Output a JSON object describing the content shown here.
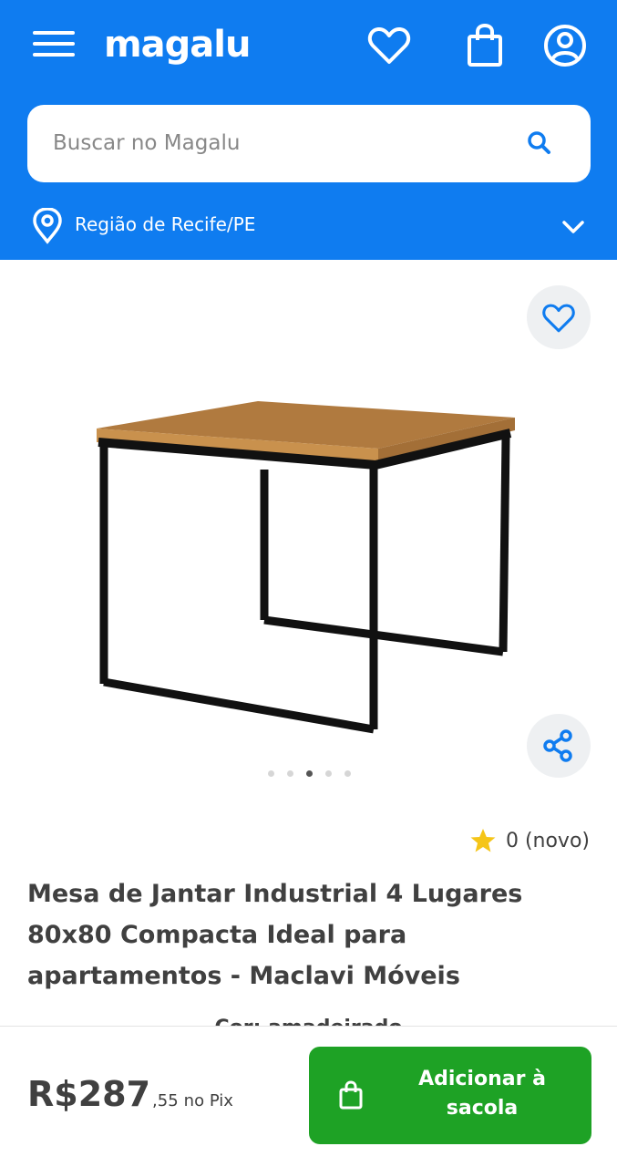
{
  "colors": {
    "brand_blue": "#0f7cf0",
    "buy_green": "#1ea225",
    "text": "#404040",
    "star": "#f5c518"
  },
  "header": {
    "logo": "magalu",
    "icons": [
      "menu-icon",
      "heart-icon",
      "bag-icon",
      "user-icon"
    ],
    "search": {
      "placeholder": "Buscar no Magalu",
      "value": ""
    },
    "region": {
      "label": "Região de Recife/PE"
    }
  },
  "gallery": {
    "image_count": 5,
    "active_index": 2
  },
  "product": {
    "rating_text": "0 (novo)",
    "title": "Mesa de Jantar Industrial 4 Lugares 80x80 Compacta Ideal para apartamentos - Maclavi Móveis",
    "variant_partial": "Cor: amadeirado"
  },
  "purchase": {
    "price_main": "R$287",
    "price_cents": ",55",
    "price_method": "no Pix",
    "add_button": "Adicionar à sacola"
  }
}
